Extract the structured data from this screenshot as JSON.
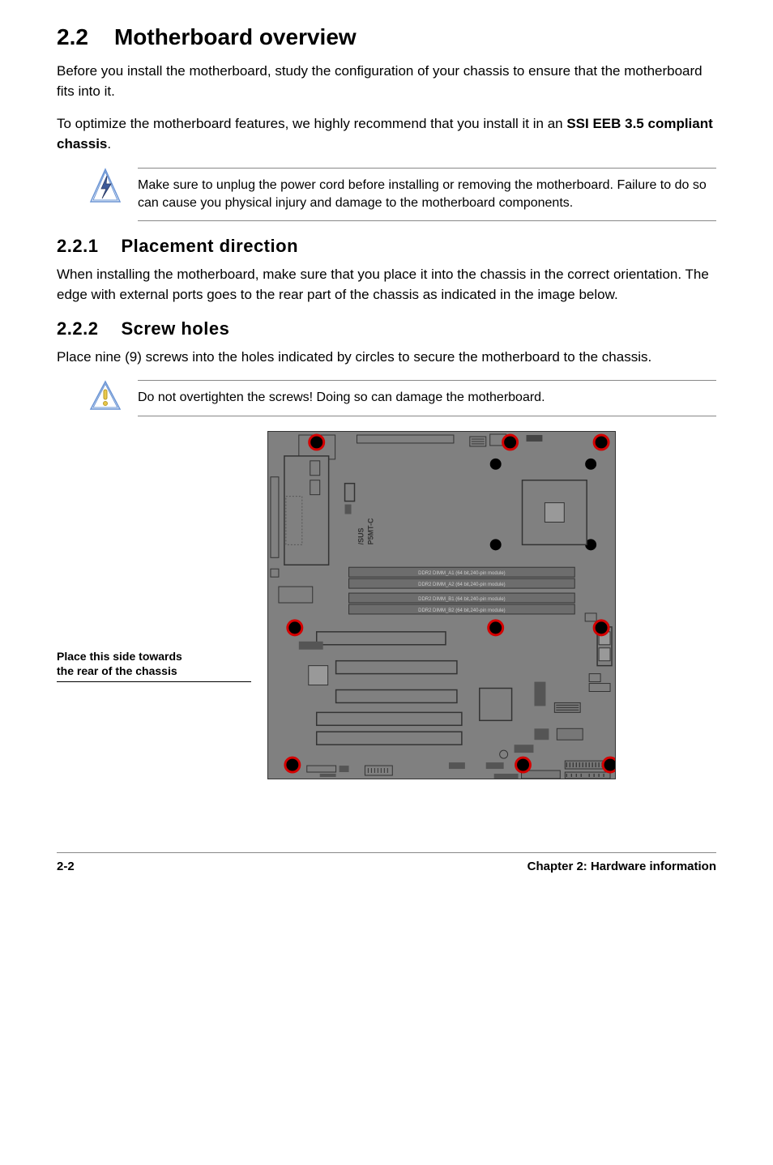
{
  "section": {
    "num": "2.2",
    "title": "Motherboard overview"
  },
  "intro_p1": "Before you install the motherboard, study the configuration of your chassis to ensure that the motherboard fits into it.",
  "intro_p2a": "To optimize the motherboard features, we highly recommend that you install it in an ",
  "intro_p2b": "SSI EEB 3.5 compliant chassis",
  "intro_p2c": ".",
  "note1": "Make sure to unplug the power cord before installing or removing the motherboard. Failure to do so can cause you physical injury and damage to the motherboard components.",
  "sub1": {
    "num": "2.2.1",
    "title": "Placement direction"
  },
  "sub1_p": "When installing the motherboard, make sure that you place it into the chassis in the correct orientation. The edge with external ports goes to the rear part of the chassis as indicated in the image below.",
  "sub2": {
    "num": "2.2.2",
    "title": "Screw holes"
  },
  "sub2_p": "Place nine (9) screws into the holes indicated by circles to secure the motherboard to the chassis.",
  "note2": "Do not overtighten the screws! Doing so can damage the motherboard.",
  "side_label_l1": "Place this side towards",
  "side_label_l2": "the rear of the chassis",
  "board": {
    "brand": "/SUS",
    "model": "P5MT-C",
    "dimm": {
      "a1": "DDR2 DIMM_A1 (64 bit,240-pin module)",
      "a2": "DDR2 DIMM_A2 (64 bit,240-pin module)",
      "b1": "DDR2 DIMM_B1 (64 bit,240-pin module)",
      "b2": "DDR2 DIMM_B2 (64 bit,240-pin module)"
    }
  },
  "footer": {
    "left": "2-2",
    "right": "Chapter 2: Hardware information"
  }
}
